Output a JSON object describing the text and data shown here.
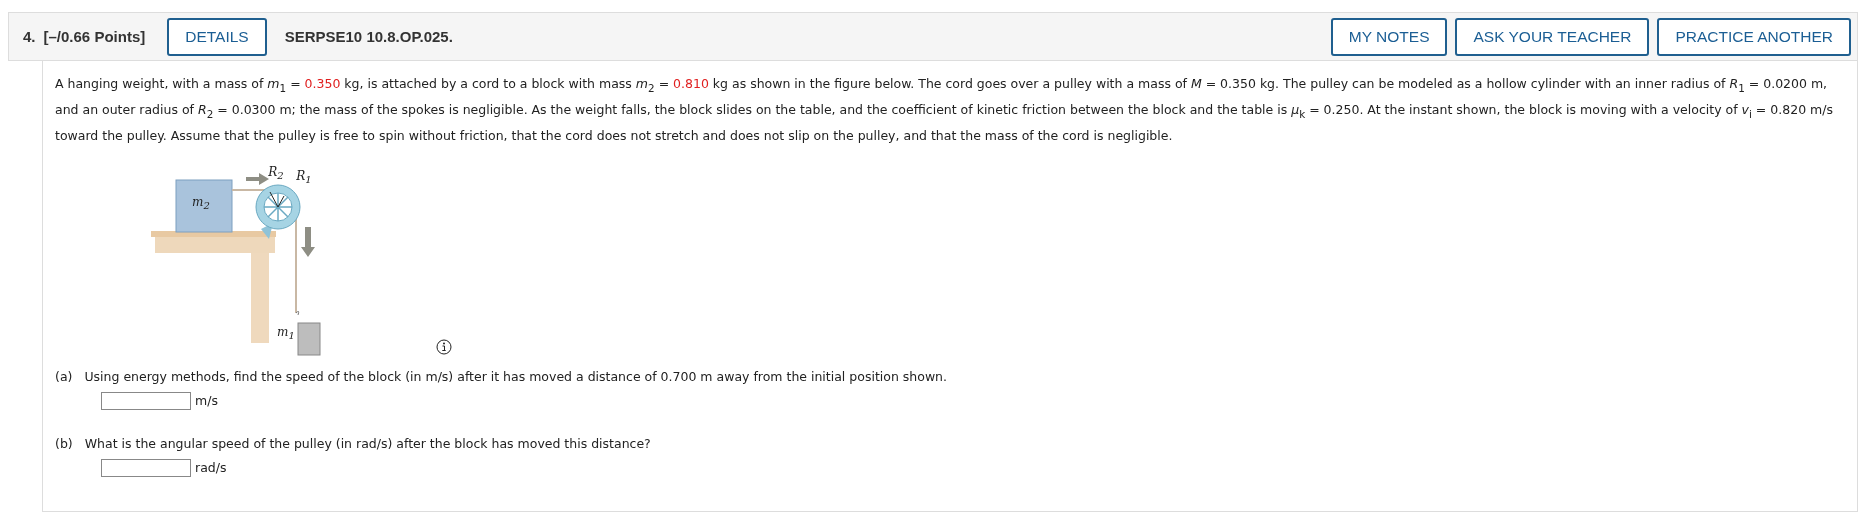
{
  "header": {
    "number": "4.",
    "points": "[–/0.66 Points]",
    "details_button": "DETAILS",
    "problem_id": "SERPSE10 10.8.OP.025.",
    "buttons": [
      "MY NOTES",
      "ASK YOUR TEACHER",
      "PRACTICE ANOTHER"
    ]
  },
  "problem": {
    "segments": [
      {
        "kind": "text",
        "text": "A hanging weight, with a mass of *m*$_{1}$ = "
      },
      {
        "kind": "given",
        "text": "0.350"
      },
      {
        "kind": "text",
        "text": " kg, is attached by a cord to a block with mass *m*$_{2}$ = "
      },
      {
        "kind": "given",
        "text": "0.810"
      },
      {
        "kind": "text",
        "text": " kg as shown in the figure below. The cord goes over a pulley with a mass of *M* = 0.350 kg. The pulley can be modeled as a hollow cylinder with an inner radius of *R*$_{1}$ = 0.0200 m, and an outer radius of *R*$_{2}$ = 0.0300 m; the mass of the spokes is negligible. As the weight falls, the block slides on the table, and the coefficient of kinetic friction between the block and the table is *μ*$_{k}$ = 0.250. At the instant shown, the block is moving with a velocity of *v*$_{i}$ = 0.820 m/s toward the pulley. Assume that the pulley is free to spin without friction, that the cord does not stretch and does not slip on the pulley, and that the mass of the cord is negligible."
      }
    ],
    "figure": {
      "block_label": "*m*$_{2}$",
      "outer_radius_label": "*R*$_{2}$",
      "inner_radius_label": "*R*$_{1}$",
      "weight_label": "*m*$_{1}$"
    }
  },
  "parts": [
    {
      "label": "(a)",
      "question": "Using energy methods, find the speed of the block (in m/s) after it has moved a distance of 0.700 m away from the initial position shown.",
      "unit": "m/s"
    },
    {
      "label": "(b)",
      "question": "What is the angular speed of the pulley (in rad/s) after the block has moved this distance?",
      "unit": "rad/s"
    }
  ]
}
